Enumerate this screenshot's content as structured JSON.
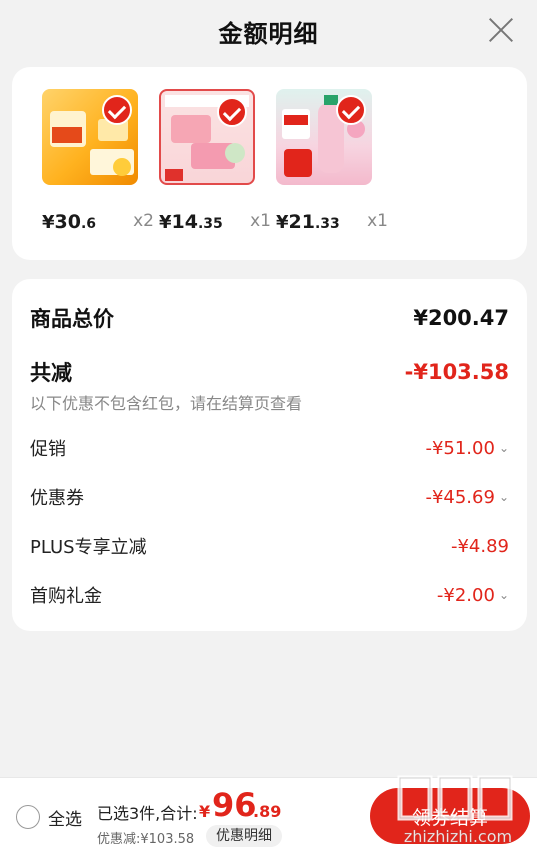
{
  "header": {
    "title": "金额明细"
  },
  "products": [
    {
      "price_int": "30",
      "price_dec": ".6",
      "qty": "x2"
    },
    {
      "price_int": "14",
      "price_dec": ".35",
      "qty": "x1"
    },
    {
      "price_int": "21",
      "price_dec": ".33",
      "qty": "x1"
    }
  ],
  "currency": "¥",
  "summary": {
    "total_label": "商品总价",
    "total_value": "¥200.47",
    "reduction_label": "共减",
    "reduction_value": "-¥103.58",
    "note": "以下优惠不包含红包，请在结算页查看",
    "items": [
      {
        "label": "促销",
        "value": "-¥51.00"
      },
      {
        "label": "优惠券",
        "value": "-¥45.69"
      },
      {
        "label": "PLUS专享立减",
        "value": "-¥4.89"
      },
      {
        "label": "首购礼金",
        "value": "-¥2.00"
      }
    ]
  },
  "bottom": {
    "select_all": "全选",
    "selected_text": "已选3件,合计:",
    "total_yen": "¥",
    "total_int": "96",
    "total_dec": ".89",
    "saved": "优惠减:¥103.58",
    "detail_button": "优惠明细",
    "checkout_button": "领券结算"
  },
  "watermark": {
    "brand": "值得值",
    "site": "zhizhizhi.com"
  },
  "colors": {
    "accent": "#e1251b",
    "background": "#f2f2f2"
  }
}
